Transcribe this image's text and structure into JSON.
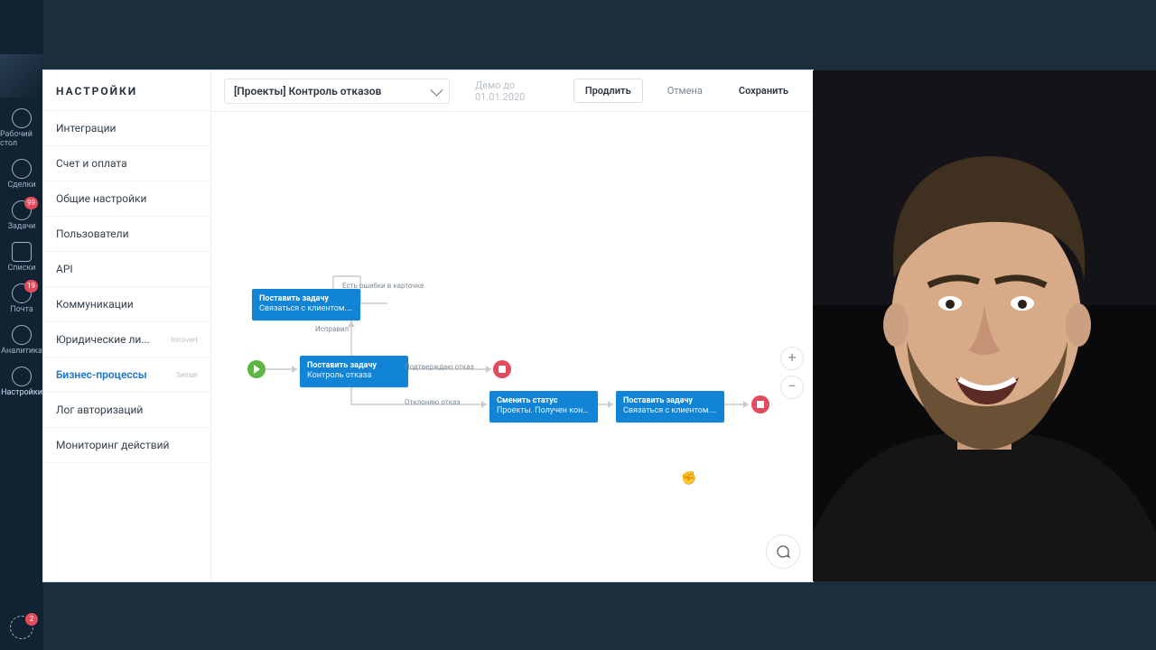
{
  "rail": {
    "items": [
      {
        "label": "Рабочий стол",
        "badge": null
      },
      {
        "label": "Сделки",
        "badge": null
      },
      {
        "label": "Задачи",
        "badge": "99"
      },
      {
        "label": "Списки",
        "badge": null
      },
      {
        "label": "Почта",
        "badge": "19"
      },
      {
        "label": "Аналитика",
        "badge": null
      },
      {
        "label": "Настройки",
        "badge": null
      }
    ],
    "bottom_badge": "2"
  },
  "settings": {
    "title": "НАСТРОЙКИ",
    "items": [
      {
        "label": "Интеграции"
      },
      {
        "label": "Счет и оплата"
      },
      {
        "label": "Общие настройки"
      },
      {
        "label": "Пользователи"
      },
      {
        "label": "API"
      },
      {
        "label": "Коммуникации"
      },
      {
        "label": "Юридические ли...",
        "tag": "Introvert"
      },
      {
        "label": "Бизнес-процессы",
        "tag": "Sensei",
        "active": true
      },
      {
        "label": "Лог авторизаций"
      },
      {
        "label": "Мониторинг действий"
      }
    ]
  },
  "topbar": {
    "process_name": "[Проекты] Контроль отказов",
    "demo_text": "Демо до 01.01.2020",
    "extend": "Продлить",
    "cancel": "Отмена",
    "save": "Сохранить"
  },
  "flow": {
    "node_a": {
      "title": "Поставить задачу",
      "subtitle": "Связаться с клиентом. Исправь..."
    },
    "node_b": {
      "title": "Поставить задачу",
      "subtitle": "Контроль отказа"
    },
    "node_c": {
      "title": "Сменить статус",
      "subtitle": "Проекты. Получен контакт"
    },
    "node_d": {
      "title": "Поставить задачу",
      "subtitle": "Связаться с клиентом. Дожать"
    },
    "label_errcard": "Есть ошибки в карточке",
    "label_fixed": "Исправил",
    "label_confirm": "Подтверждаю отказ",
    "label_reject": "Отклоняю отказ"
  },
  "zoom": {
    "in": "+",
    "out": "−"
  }
}
